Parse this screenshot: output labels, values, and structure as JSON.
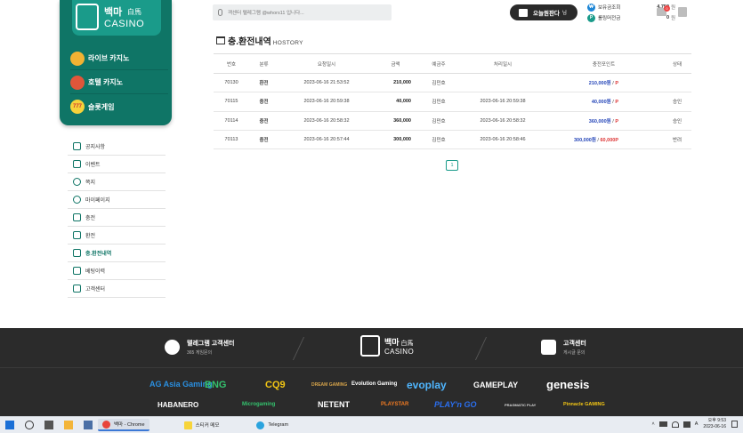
{
  "brand": {
    "name_kr": "백마",
    "name_cn": "白馬",
    "name_en": "CASINO"
  },
  "game_menu": [
    {
      "label": "라이브 카지노",
      "icon": "dealer-icon"
    },
    {
      "label": "호텔 카지노",
      "icon": "roulette-icon"
    },
    {
      "label": "슬롯게임",
      "icon": "slot-777-icon",
      "icon_text": "777"
    }
  ],
  "nav": [
    {
      "label": "공지사항",
      "icon": "megaphone-icon"
    },
    {
      "label": "이벤트",
      "icon": "gift-icon"
    },
    {
      "label": "쪽지",
      "icon": "chat-icon"
    },
    {
      "label": "마이페이지",
      "icon": "gear-icon"
    },
    {
      "label": "충전",
      "icon": "deposit-icon"
    },
    {
      "label": "환전",
      "icon": "withdraw-icon"
    },
    {
      "label": "충.환전내역",
      "icon": "bank-icon",
      "active": true
    },
    {
      "label": "베팅이력",
      "icon": "list-icon"
    },
    {
      "label": "고객센터",
      "icon": "support-icon"
    }
  ],
  "search": {
    "placeholder": "객센터 텔레그램 @whors11 입니다..."
  },
  "header": {
    "attend_label": "오늘뭔판다",
    "attend_suffix": "님",
    "balance_label": "보유금조회",
    "balance_value": "4,750",
    "balance_unit": "원",
    "rolling_label": "롤링머전금",
    "rolling_value": "0",
    "rolling_unit": "원",
    "message_count": "0"
  },
  "page": {
    "title": "충.환전내역",
    "subtitle": "HOSTORY"
  },
  "table": {
    "headers": [
      "번호",
      "분류",
      "요청일시",
      "금액",
      "예금주",
      "처리일시",
      "충전포인트",
      "상태"
    ],
    "rows": [
      {
        "no": "70130",
        "type": "환전",
        "req": "2023-06-16 21:53:52",
        "amount": "210,000",
        "holder": "김민호",
        "proc": "",
        "won": "210,000원",
        "sep": " / ",
        "point": "P",
        "status": ""
      },
      {
        "no": "70115",
        "type": "충전",
        "req": "2023-06-16 20:59:38",
        "amount": "40,000",
        "holder": "김민호",
        "proc": "2023-06-16 20:59:38",
        "won": "40,000원",
        "sep": " / ",
        "point": "P",
        "status": "승인"
      },
      {
        "no": "70114",
        "type": "충전",
        "req": "2023-06-16 20:58:32",
        "amount": "360,000",
        "holder": "김민호",
        "proc": "2023-06-16 20:58:32",
        "won": "360,000원",
        "sep": " / ",
        "point": "P",
        "status": "승인"
      },
      {
        "no": "70113",
        "type": "충전",
        "req": "2023-06-16 20:57:44",
        "amount": "300,000",
        "holder": "김민호",
        "proc": "2023-06-16 20:58:46",
        "won": "300,000원",
        "sep": " / ",
        "point": "60,000P",
        "status": "반려"
      }
    ]
  },
  "pagination": {
    "current": "1"
  },
  "footer": {
    "telegram_title": "텔레그램 고객센터",
    "telegram_sub": "365 게임문의",
    "support_title": "고객센터",
    "support_sub": "게시글 문의",
    "providers_row1": [
      "AG Asia Gaming",
      "BNG",
      "CQ9",
      "DREAM GAMING",
      "Evolution Gaming",
      "evoplay",
      "GAMEPLAY",
      "genesis"
    ],
    "providers_row2": [
      "HABANERO",
      "Microgaming",
      "NETENT",
      "PLAYSTAR",
      "PLAY'n GO",
      "PRAGMATIC PLAY",
      "Pinnacle GAMING"
    ]
  },
  "taskbar": {
    "apps": [
      {
        "label": "백마 - Chrome",
        "active": true
      },
      {
        "label": "스티커 메모",
        "active": false
      },
      {
        "label": "Telegram",
        "active": false
      }
    ],
    "lang": "A",
    "time": "오후 9:53",
    "date": "2023-06-16"
  },
  "colors": {
    "brand_teal": "#0f7566",
    "accent_teal": "#1a9b8a",
    "point_blue": "#2445b8",
    "point_red": "#d33",
    "footer_bg": "#2b2b2b"
  }
}
